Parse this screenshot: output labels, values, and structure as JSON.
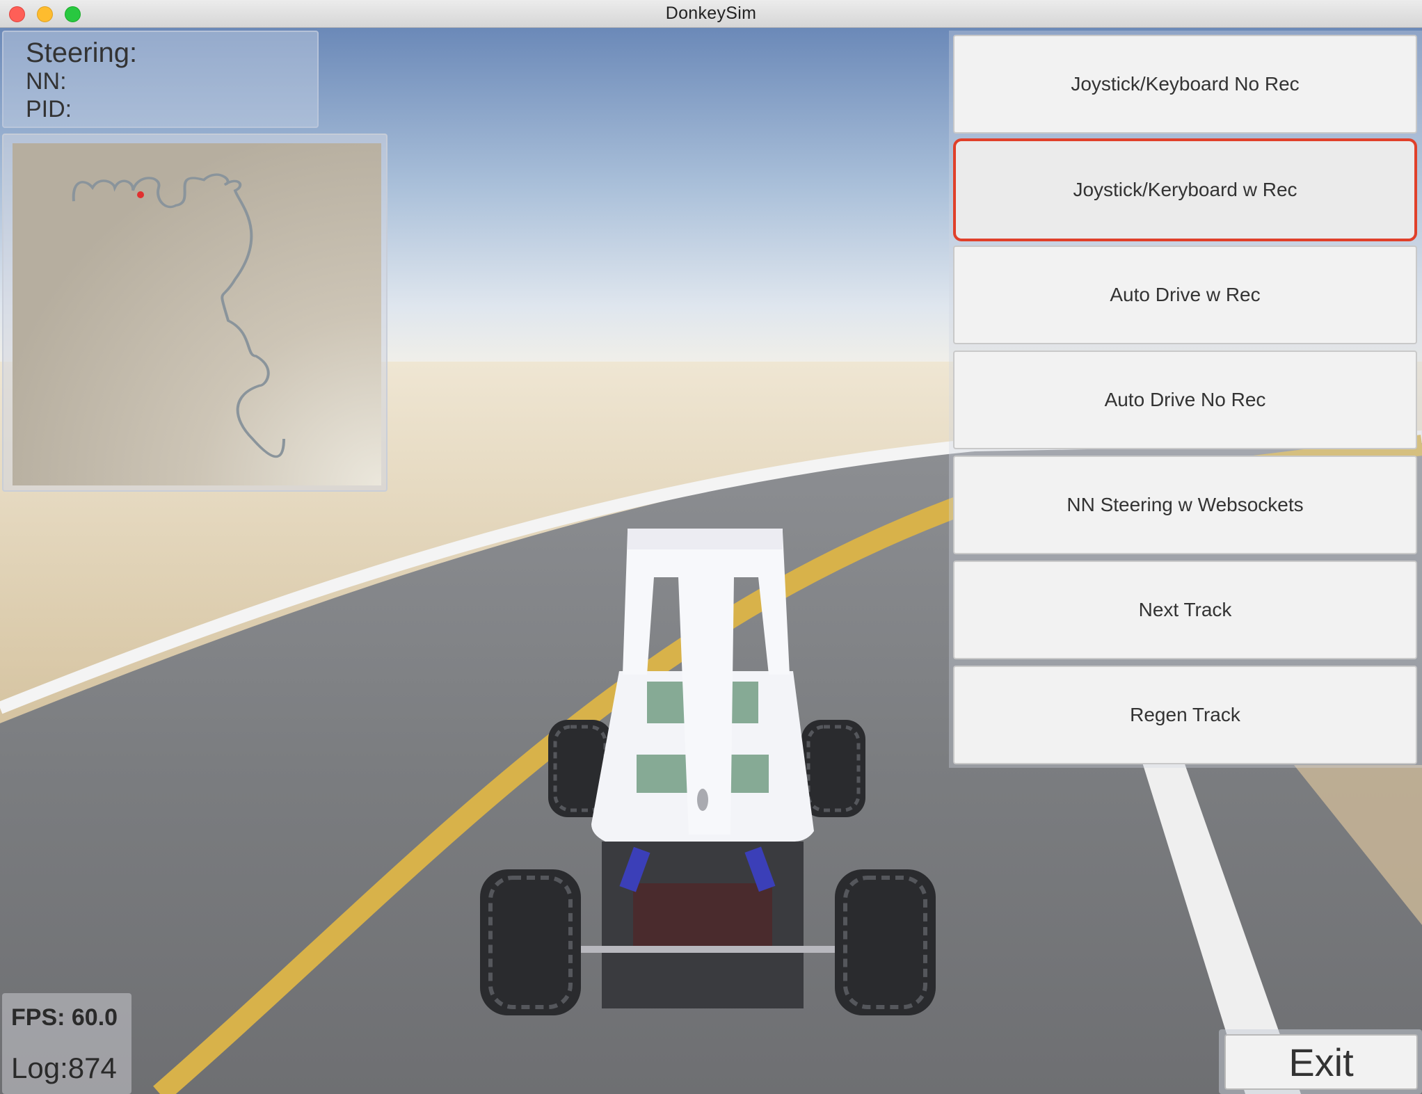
{
  "window": {
    "title": "DonkeySim"
  },
  "hud": {
    "steering_label": "Steering:",
    "nn_label": "NN:",
    "pid_label": "PID:",
    "fps": "FPS: 60.0",
    "log": "Log:874"
  },
  "menu": {
    "buttons": [
      {
        "label": "Joystick/Keyboard No Rec",
        "selected": false
      },
      {
        "label": "Joystick/Keryboard w Rec",
        "selected": true
      },
      {
        "label": "Auto Drive w Rec",
        "selected": false
      },
      {
        "label": "Auto Drive No Rec",
        "selected": false
      },
      {
        "label": "NN Steering w Websockets",
        "selected": false
      },
      {
        "label": "Next Track",
        "selected": false
      },
      {
        "label": "Regen Track",
        "selected": false
      }
    ],
    "exit_label": "Exit"
  },
  "colors": {
    "selected_outline": "#e0402a",
    "lane_line_yellow": "#d8b24a",
    "car_chassis": "#f3f4f8",
    "map_marker": "#e03030"
  }
}
